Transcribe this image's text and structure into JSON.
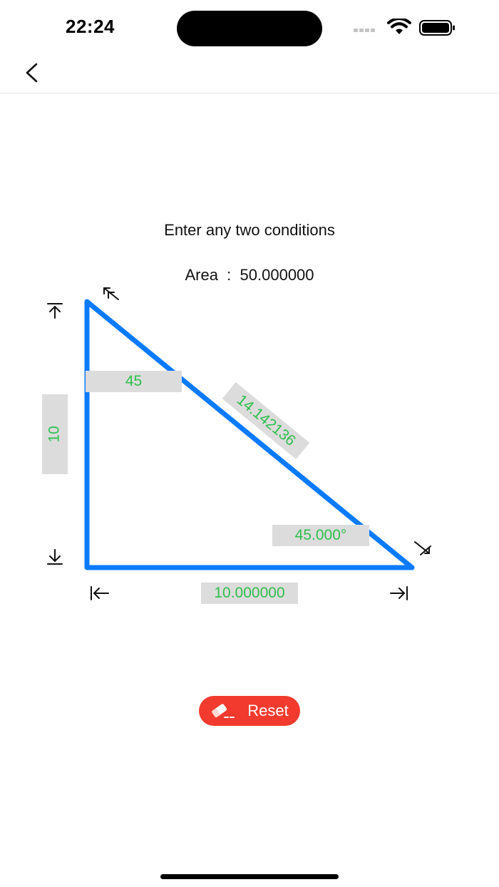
{
  "status": {
    "time": "22:24"
  },
  "nav": {
    "back_icon": "chevron-left-icon"
  },
  "instruction": "Enter any two conditions",
  "area": {
    "label": "Area",
    "separator": ":",
    "value": "50.000000"
  },
  "triangle": {
    "height_value": "10",
    "top_angle_value": "45",
    "hypotenuse_value": "14.142136",
    "bottom_angle_value": "45.000°",
    "base_value": "10.000000",
    "stroke_color": "#0a7aff",
    "value_color": "#2fbf4d"
  },
  "reset": {
    "label": "Reset",
    "icon": "eraser-icon",
    "color": "#f23a2f"
  }
}
